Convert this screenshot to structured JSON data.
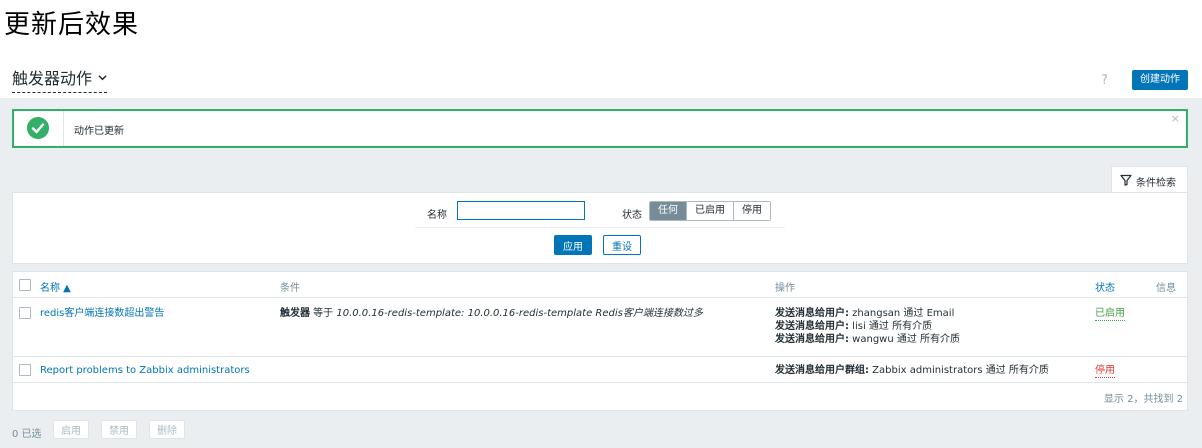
{
  "doc_heading": "更新后效果",
  "header": {
    "title": "触发器动作",
    "help": "?",
    "create_button": "创建动作"
  },
  "message": {
    "text": "动作已更新",
    "close": "×"
  },
  "filter": {
    "tab_label": "条件检索",
    "name_label": "名称",
    "name_value": "",
    "status_label": "状态",
    "status_options": [
      "任何",
      "已启用",
      "停用"
    ],
    "status_selected": "任何",
    "apply_button": "应用",
    "reset_button": "重设"
  },
  "table": {
    "columns": {
      "name": "名称 ▲",
      "conditions": "条件",
      "operations": "操作",
      "status": "状态",
      "info": "信息"
    },
    "rows": [
      {
        "name": "redis客户端连接数超出警告",
        "condition_prefix": "触发器",
        "condition_op": " 等于 ",
        "condition_value": "10.0.0.16-redis-template: 10.0.0.16-redis-template Redis客户端连接数过多",
        "operations": [
          {
            "label": "发送消息给用户:",
            "text": " zhangsan 通过 Email"
          },
          {
            "label": "发送消息给用户:",
            "text": " lisi 通过 所有介质"
          },
          {
            "label": "发送消息给用户:",
            "text": " wangwu 通过 所有介质"
          }
        ],
        "status": "已启用"
      },
      {
        "name": "Report problems to Zabbix administrators",
        "operations": [
          {
            "label": "发送消息给用户群组:",
            "text": " Zabbix administrators 通过 所有介质"
          }
        ],
        "status": "停用"
      }
    ],
    "summary": "显示 2，共找到 2"
  },
  "footer": {
    "selected": "0 已选",
    "enable_button": "启用",
    "disable_button": "禁用",
    "delete_button": "删除"
  },
  "colors": {
    "accent": "#0275b8",
    "success": "#34af67",
    "enabled": "#429e47",
    "disabled": "#e33734"
  }
}
